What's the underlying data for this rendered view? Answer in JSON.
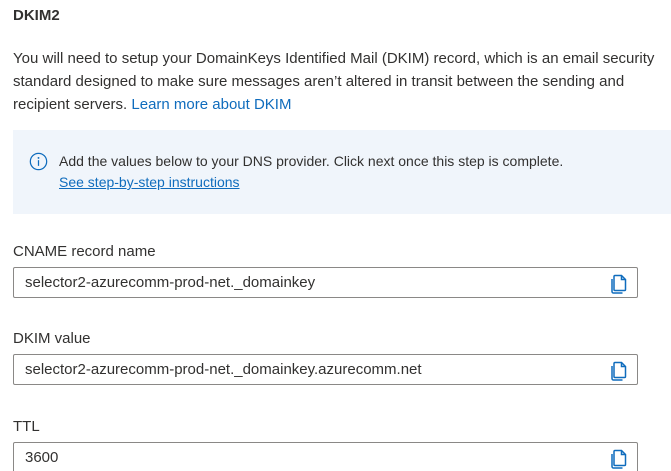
{
  "section": {
    "title": "DKIM2",
    "description": "You will need to setup your DomainKeys Identified Mail (DKIM) record, which is an email security standard designed to make sure messages aren’t altered in transit between the sending and recipient servers.",
    "learn_more_link": "Learn more about DKIM"
  },
  "info": {
    "icon": "info-icon",
    "text": "Add the values below to your DNS provider. Click next once this step is complete.",
    "link": "See step-by-step instructions"
  },
  "fields": {
    "cname": {
      "label": "CNAME record name",
      "value": "selector2-azurecomm-prod-net._domainkey"
    },
    "dkim": {
      "label": "DKIM value",
      "value": "selector2-azurecomm-prod-net._domainkey.azurecomm.net"
    },
    "ttl": {
      "label": "TTL",
      "value": "3600"
    }
  },
  "colors": {
    "link": "#0f6cbd",
    "info_background": "#f0f5fb",
    "text": "#323130",
    "border": "#8a8886"
  },
  "icons": {
    "copy": "copy-icon"
  }
}
